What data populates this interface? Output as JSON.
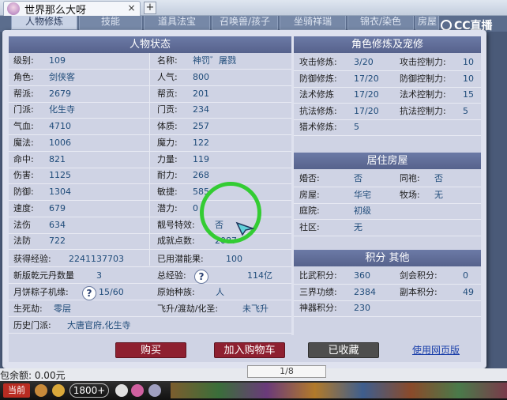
{
  "browser": {
    "tab_title": "世界那么大呀",
    "close_glyph": "×",
    "add_glyph": "+",
    "logo_text": "CC直播"
  },
  "nav_tabs": [
    "人物修炼",
    "技能",
    "道具法宝",
    "召唤兽/孩子",
    "坐骑祥瑞",
    "锦衣/染色",
    "房屋"
  ],
  "character": {
    "section_title": "人物状态",
    "left_rows": [
      {
        "label": "级别:",
        "value": "109"
      },
      {
        "label": "角色:",
        "value": "剑侠客"
      },
      {
        "label": "帮派:",
        "value": "2679"
      },
      {
        "label": "门派:",
        "value": "化生寺"
      },
      {
        "label": "气血:",
        "value": "4710"
      },
      {
        "label": "魔法:",
        "value": "1006"
      },
      {
        "label": "命中:",
        "value": "821"
      },
      {
        "label": "伤害:",
        "value": "1125"
      },
      {
        "label": "防御:",
        "value": "1304"
      },
      {
        "label": "速度:",
        "value": "679"
      },
      {
        "label": "法伤",
        "value": "634"
      },
      {
        "label": "法防",
        "value": "722"
      }
    ],
    "right_rows": [
      {
        "label": "名称:",
        "value": "神罚゛屠戮"
      },
      {
        "label": "人气:",
        "value": "800"
      },
      {
        "label": "帮贡:",
        "value": "201"
      },
      {
        "label": "门贡:",
        "value": "234"
      },
      {
        "label": "体质:",
        "value": "257"
      },
      {
        "label": "魔力:",
        "value": "122"
      },
      {
        "label": "力量:",
        "value": "119"
      },
      {
        "label": "耐力:",
        "value": "268"
      },
      {
        "label": "敏捷:",
        "value": "585"
      },
      {
        "label": "潜力:",
        "value": "0"
      },
      {
        "label": "靓号特效:",
        "value": "否"
      },
      {
        "label": "成就点数:",
        "value": "2087"
      }
    ],
    "extra": {
      "exp_label": "获得经验:",
      "exp_value": "2241137703",
      "potential_used_label": "已用潜能果:",
      "potential_used_value": "100",
      "qiankun_label": "新版乾元丹数量",
      "qiankun_value": "3",
      "total_exp_label": "总经验:",
      "total_exp_value": "114亿",
      "yuebing_label": "月饼粽子机缘:",
      "yuebing_value": "15/60",
      "origin_race_label": "原始种族:",
      "origin_race_value": "人",
      "shengsi_label": "生死劫:",
      "shengsi_value": "零层",
      "feisheng_label": "飞升/渡劫/化圣:",
      "feisheng_value": "未飞升",
      "history_label": "历史门派:",
      "history_value": "大唐官府,化生寺",
      "question_glyph": "?"
    }
  },
  "cultivation": {
    "section_title": "角色修炼及宠修",
    "rows": [
      {
        "label": "攻击修炼:",
        "value": "3/20",
        "label2": "攻击控制力:",
        "value2": "10"
      },
      {
        "label": "防御修炼:",
        "value": "17/20",
        "label2": "防御控制力:",
        "value2": "10"
      },
      {
        "label": "法术修炼",
        "value": "17/20",
        "label2": "法术控制力:",
        "value2": "15"
      },
      {
        "label": "抗法修炼:",
        "value": "17/20",
        "label2": "抗法控制力:",
        "value2": "5"
      },
      {
        "label": "猎术修炼:",
        "value": "5",
        "label2": "",
        "value2": ""
      }
    ]
  },
  "housing": {
    "section_title": "居住房屋",
    "rows": [
      {
        "label": "婚否:",
        "value": "否",
        "label2": "同袍:",
        "value2": "否"
      },
      {
        "label": "房屋:",
        "value": "华宅",
        "label2": "牧场:",
        "value2": "无"
      },
      {
        "label": "庭院:",
        "value": "初级",
        "label2": "",
        "value2": ""
      },
      {
        "label": "社区:",
        "value": "无",
        "label2": "",
        "value2": ""
      }
    ]
  },
  "points": {
    "section_title": "积分 其他",
    "rows": [
      {
        "label": "比武积分:",
        "value": "360",
        "label2": "剑会积分:",
        "value2": "0"
      },
      {
        "label": "三界功绩:",
        "value": "2384",
        "label2": "副本积分:",
        "value2": "49"
      },
      {
        "label": "神器积分:",
        "value": "230",
        "label2": "",
        "value2": ""
      }
    ]
  },
  "actions": {
    "buy": "购买",
    "add_cart": "加入购物车",
    "favorited": "已收藏",
    "web_version": "使用网页版"
  },
  "background": {
    "balance_text": "包余额: 0.00元",
    "page_text": "1/8"
  },
  "taskbar": {
    "current_label": "当前",
    "count_label": "1800+"
  },
  "colors": {
    "section_header": "#5e6a96",
    "value_text": "#204c7a",
    "buy_button": "#8e2030",
    "fav_button": "#4e4e4e",
    "ring": "#33cc33"
  }
}
